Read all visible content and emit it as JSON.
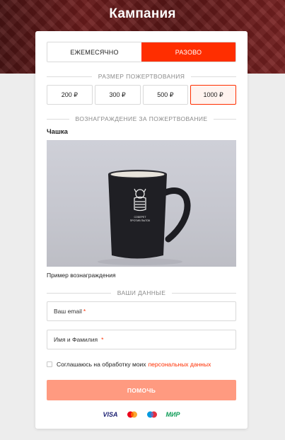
{
  "header": {
    "title": "Кампания"
  },
  "frequency": {
    "options": [
      {
        "label": "ЕЖЕМЕСЯЧНО",
        "selected": false
      },
      {
        "label": "РАЗОВО",
        "selected": true
      }
    ]
  },
  "donation": {
    "section_label": "РАЗМЕР ПОЖЕРТВОВАНИЯ",
    "amounts": [
      {
        "label": "200 ₽",
        "selected": false
      },
      {
        "label": "300 ₽",
        "selected": false
      },
      {
        "label": "500 ₽",
        "selected": false
      },
      {
        "label": "1000 ₽",
        "selected": true
      }
    ]
  },
  "reward": {
    "section_label": "ВОЗНАГРАЖДЕНИЕ ЗА ПОЖЕРТВОВАНИЕ",
    "name": "Чашка",
    "caption": "Пример вознаграждения"
  },
  "user_data": {
    "section_label": "ВАШИ ДАННЫЕ",
    "email_label": "Ваш email",
    "name_label": "Имя и Фамилия",
    "required_mark": "*"
  },
  "consent": {
    "text": "Соглашаюсь на обработку моих",
    "link_text": "персональных данных",
    "checked": false
  },
  "submit": {
    "label": "ПОМОЧЬ"
  },
  "payment_methods": [
    "VISA",
    "mastercard-icon",
    "maestro-icon",
    "МИР"
  ],
  "colors": {
    "accent": "#ff2e00",
    "submit_disabled": "#ff9a80",
    "selected_amount_bg": "#fff3ef"
  }
}
